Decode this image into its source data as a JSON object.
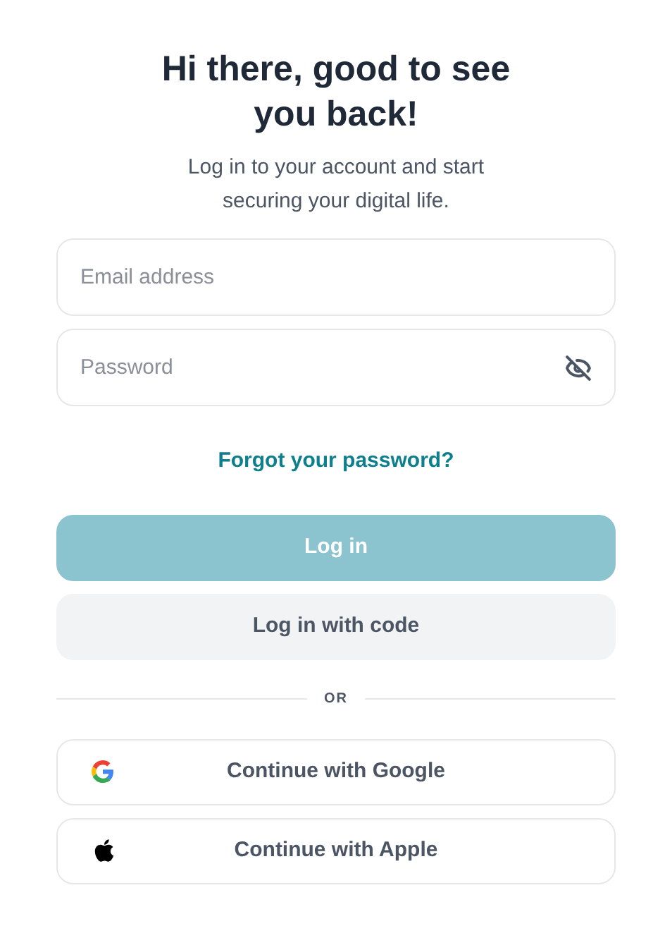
{
  "title": "Hi there, good to see you back!",
  "subtitle": "Log in to your account and start securing your digital life.",
  "email": {
    "placeholder": "Email address"
  },
  "password": {
    "placeholder": "Password",
    "visible": false
  },
  "forgot_link": "Forgot your password?",
  "login_button": {
    "label": "Log in",
    "disabled": true
  },
  "code_button": {
    "label": "Log in with code"
  },
  "divider": "OR",
  "social_buttons": [
    {
      "kind": "google",
      "label": "Continue with Google"
    },
    {
      "kind": "apple",
      "label": "Continue with Apple"
    }
  ]
}
